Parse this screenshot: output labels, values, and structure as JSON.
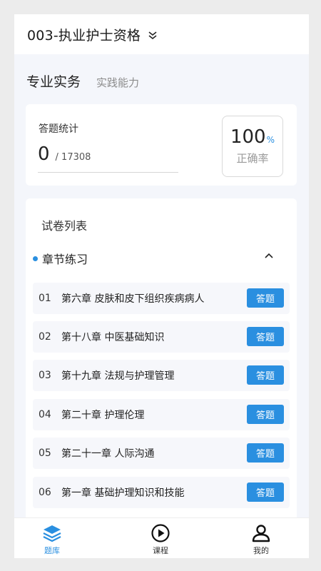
{
  "header": {
    "title": "003-执业护士资格",
    "dropdown_icon": "chevron-down-icon"
  },
  "subjects": {
    "active": "专业实务",
    "inactive": "实践能力"
  },
  "stats": {
    "label": "答题统计",
    "answered": "0",
    "total": "/ 17308",
    "accuracy": "100",
    "accuracy_unit": "%",
    "accuracy_label": "正确率"
  },
  "papers": {
    "title": "试卷列表",
    "section": "章节练习",
    "action_label": "答题",
    "items": [
      {
        "index": "01",
        "name": "第六章 皮肤和皮下组织疾病病人"
      },
      {
        "index": "02",
        "name": "第十八章 中医基础知识"
      },
      {
        "index": "03",
        "name": "第十九章 法规与护理管理"
      },
      {
        "index": "04",
        "name": "第二十章 护理伦理"
      },
      {
        "index": "05",
        "name": "第二十一章 人际沟通"
      },
      {
        "index": "06",
        "name": "第一章 基础护理知识和技能"
      }
    ]
  },
  "tabbar": {
    "items": [
      {
        "label": "题库",
        "icon": "layers-icon",
        "active": true
      },
      {
        "label": "课程",
        "icon": "play-circle-icon",
        "active": false
      },
      {
        "label": "我的",
        "icon": "user-icon",
        "active": false
      }
    ]
  },
  "colors": {
    "accent": "#2a8fe0",
    "background": "#f4f6fb",
    "row": "#f6f7fb"
  }
}
